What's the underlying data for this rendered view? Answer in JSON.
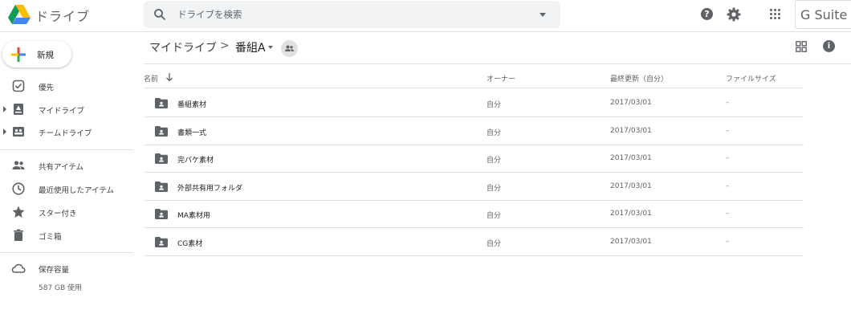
{
  "app": {
    "name": "ドライブ",
    "suite_label": "G Suite"
  },
  "search": {
    "placeholder": "ドライブを検索"
  },
  "topbar_icons": [
    "help-icon",
    "gear-icon",
    "apps-grid-icon"
  ],
  "new_button": {
    "label": "新規"
  },
  "sidebar": {
    "items": [
      {
        "label": "優先",
        "icon": "priority-checkbox-icon",
        "expandable": false
      },
      {
        "label": "マイドライブ",
        "icon": "my-drive-icon",
        "expandable": true
      },
      {
        "label": "チームドライブ",
        "icon": "team-drive-icon",
        "expandable": true
      },
      {
        "label": "共有アイテム",
        "icon": "people-icon",
        "expandable": false
      },
      {
        "label": "最近使用したアイテム",
        "icon": "clock-icon",
        "expandable": false
      },
      {
        "label": "スター付き",
        "icon": "star-icon",
        "expandable": false
      },
      {
        "label": "ゴミ箱",
        "icon": "trash-icon",
        "expandable": false
      }
    ],
    "storage": {
      "label": "保存容量",
      "usage": "587 GB 使用"
    }
  },
  "breadcrumb": {
    "root": "マイドライブ",
    "separator": ">",
    "current": "番組A"
  },
  "table": {
    "columns": {
      "name": "名前",
      "owner": "オーナー",
      "modified": "最終更新（自分）",
      "size": "ファイルサイズ"
    },
    "rows": [
      {
        "name": "番組素材",
        "owner": "自分",
        "modified": "2017/03/01",
        "size": "–"
      },
      {
        "name": "書類一式",
        "owner": "自分",
        "modified": "2017/03/01",
        "size": "–"
      },
      {
        "name": "完パケ素材",
        "owner": "自分",
        "modified": "2017/03/01",
        "size": "–"
      },
      {
        "name": "外部共有用フォルダ",
        "owner": "自分",
        "modified": "2017/03/01",
        "size": "–"
      },
      {
        "name": "MA素材用",
        "owner": "自分",
        "modified": "2017/03/01",
        "size": "–"
      },
      {
        "name": "CG素材",
        "owner": "自分",
        "modified": "2017/03/01",
        "size": "–"
      }
    ]
  },
  "colors": {
    "icon_gray": "#5f6368",
    "divider": "#e0e0e0",
    "search_bg": "#f1f3f4"
  }
}
